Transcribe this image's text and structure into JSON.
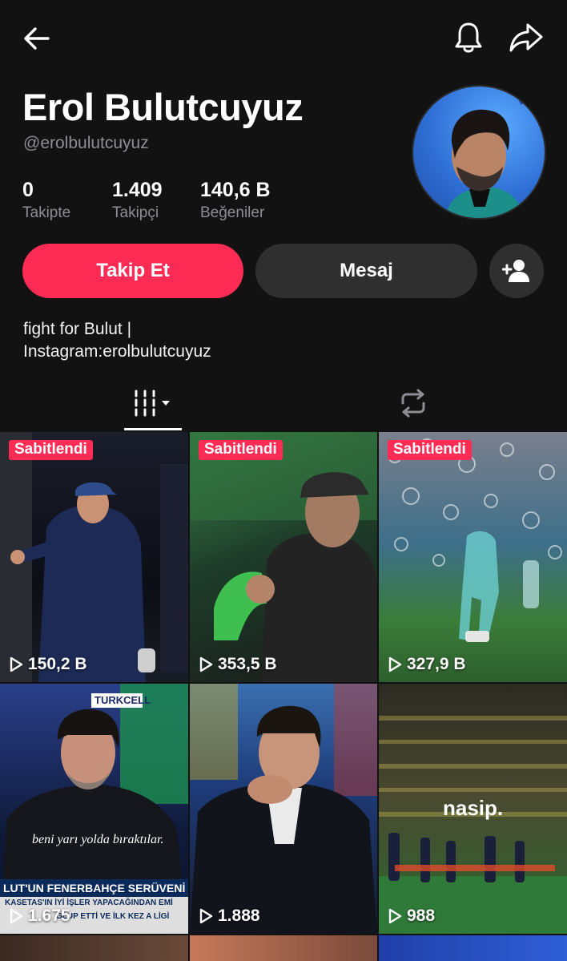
{
  "profile": {
    "name": "Erol Bulutcuyuz",
    "handle": "@erolbulutcuyuz",
    "bio_line1": "fight for Bulut |",
    "bio_line2": "Instagram:erolbulutcuyuz"
  },
  "stats": {
    "following_count": "0",
    "following_label": "Takipte",
    "followers_count": "1.409",
    "followers_label": "Takipçi",
    "likes_count": "140,6 B",
    "likes_label": "Beğeniler"
  },
  "actions": {
    "follow_label": "Takip Et",
    "message_label": "Mesaj"
  },
  "colors": {
    "accent": "#fe2c55",
    "background": "#121212",
    "secondary_button": "#2f2f2f",
    "muted_text": "#8e8e93"
  },
  "icons": {
    "back": "arrow-left-icon",
    "bell": "bell-icon",
    "share": "share-arrow-icon",
    "add_friend": "add-person-icon",
    "videos_tab": "grid-filter-icon",
    "reposts_tab": "repost-icon",
    "play": "play-icon"
  },
  "videos": [
    {
      "pinned_label": "Sabitlendi",
      "views": "150,2 B"
    },
    {
      "pinned_label": "Sabitlendi",
      "views": "353,5 B"
    },
    {
      "pinned_label": "Sabitlendi",
      "views": "327,9 B"
    },
    {
      "views": "1.675",
      "caption": "beni yarı yolda bıraktılar.",
      "banner_title": "LUT'UN FENERBAHÇE SERÜVENİ",
      "banner_sub": "KASETAS'IN İYİ İŞLER YAPACAĞINDAN EMİ",
      "banner_sub2": "GLUP ETTİ VE İLK KEZ A LİGİ",
      "sponsor": "TURKCELL"
    },
    {
      "views": "1.888"
    },
    {
      "views": "988",
      "caption": "nasip."
    }
  ]
}
